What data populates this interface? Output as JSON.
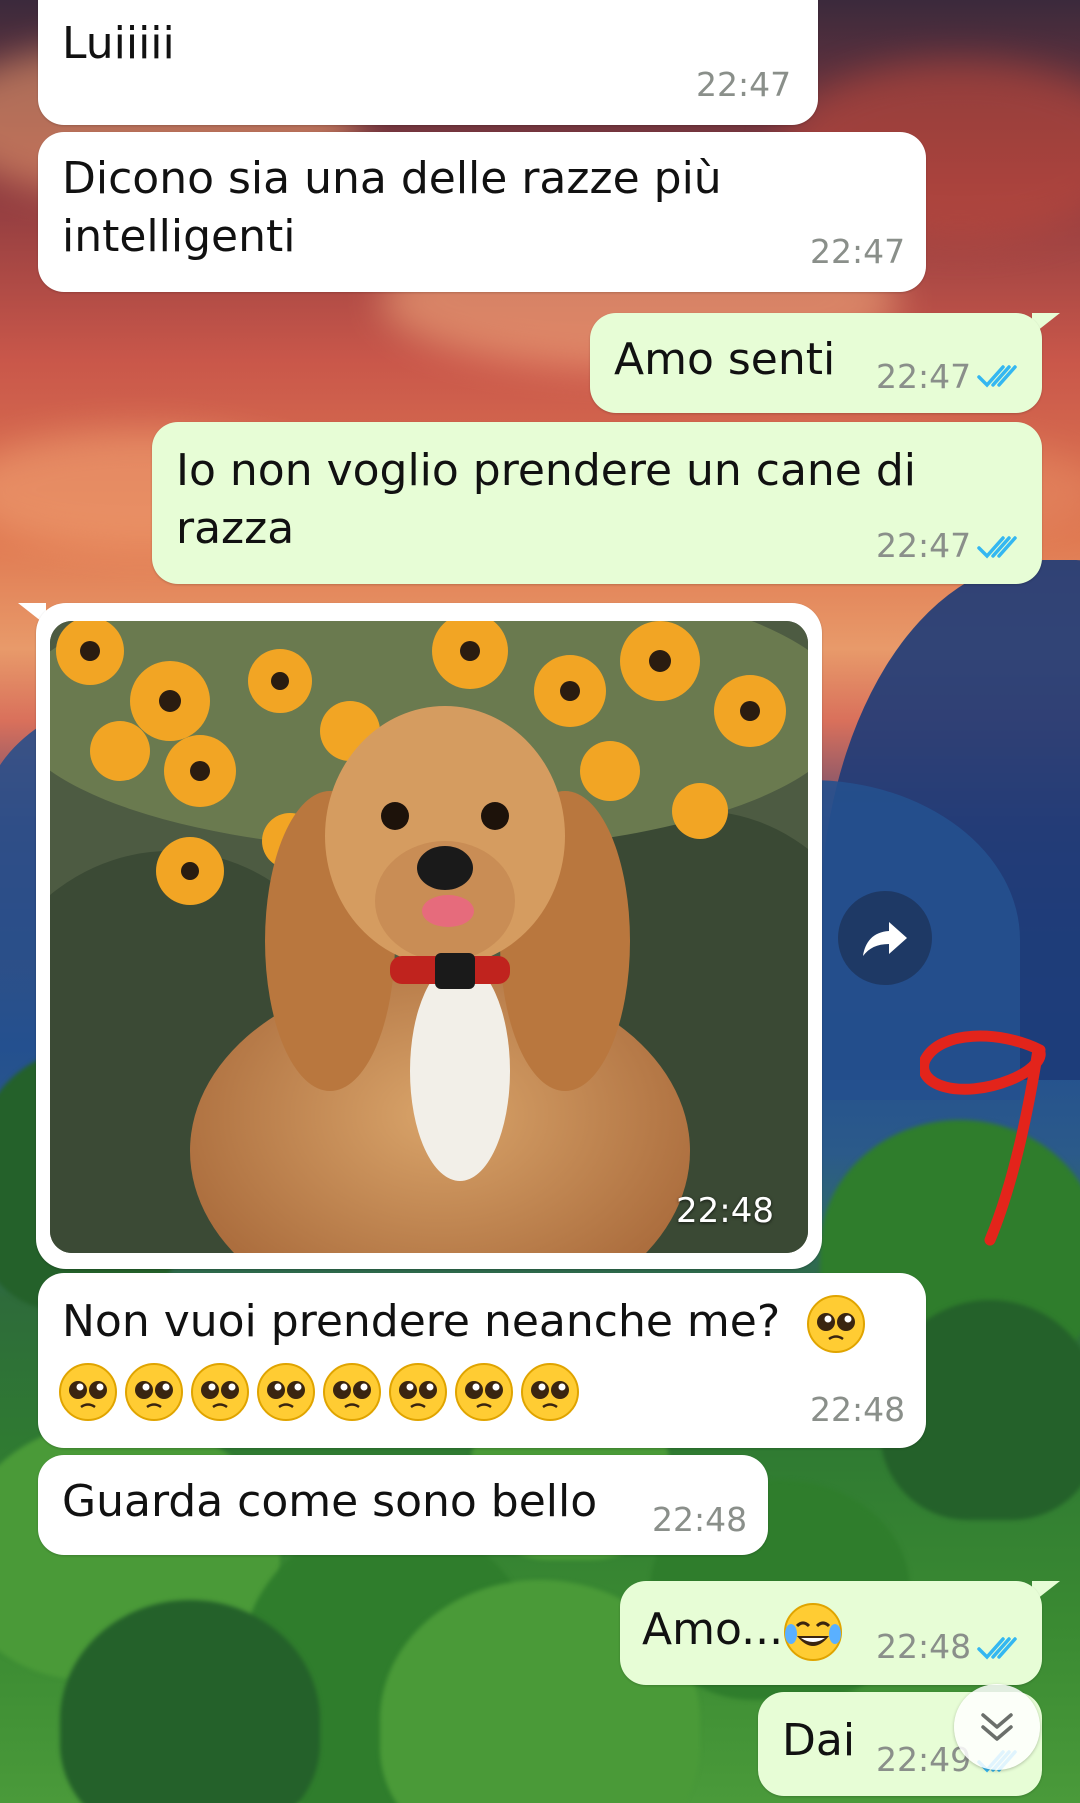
{
  "colors": {
    "incoming_bubble": "#ffffff",
    "outgoing_bubble": "#e7fdd6",
    "read_ticks": "#34b7f1",
    "timestamp": "#8a8f8a",
    "annotation_red": "#e3241b"
  },
  "messages": [
    {
      "direction": "in",
      "lines": [
        "Luiiiii"
      ],
      "time": "22:47"
    },
    {
      "direction": "in",
      "lines": [
        "Dicono sia una delle razze più",
        "intelligenti"
      ],
      "time": "22:47"
    },
    {
      "direction": "out",
      "lines": [
        "Amo senti"
      ],
      "time": "22:47",
      "status": "read"
    },
    {
      "direction": "out",
      "lines": [
        "Io non voglio prendere un cane di",
        "razza"
      ],
      "time": "22:47",
      "status": "read"
    },
    {
      "direction": "in",
      "type": "image",
      "image_subject": "cocker spaniel dog with sunflowers",
      "time": "22:48"
    },
    {
      "direction": "in",
      "lines": [
        "Non vuoi prendere neanche me?"
      ],
      "emoji": "pleading-face",
      "emoji_count": 9,
      "time": "22:48"
    },
    {
      "direction": "in",
      "lines": [
        "Guarda come sono bello"
      ],
      "time": "22:48"
    },
    {
      "direction": "out",
      "lines": [
        "Amo..."
      ],
      "emoji": "tears-of-joy",
      "time": "22:48",
      "status": "read"
    },
    {
      "direction": "out",
      "lines": [
        "Dai"
      ],
      "time": "22:49",
      "status": "read"
    }
  ],
  "annotation": {
    "text": "9"
  },
  "icons": {
    "forward": "forward-arrow-icon",
    "scroll_down": "double-chevron-down-icon",
    "read": "double-check-icon"
  }
}
